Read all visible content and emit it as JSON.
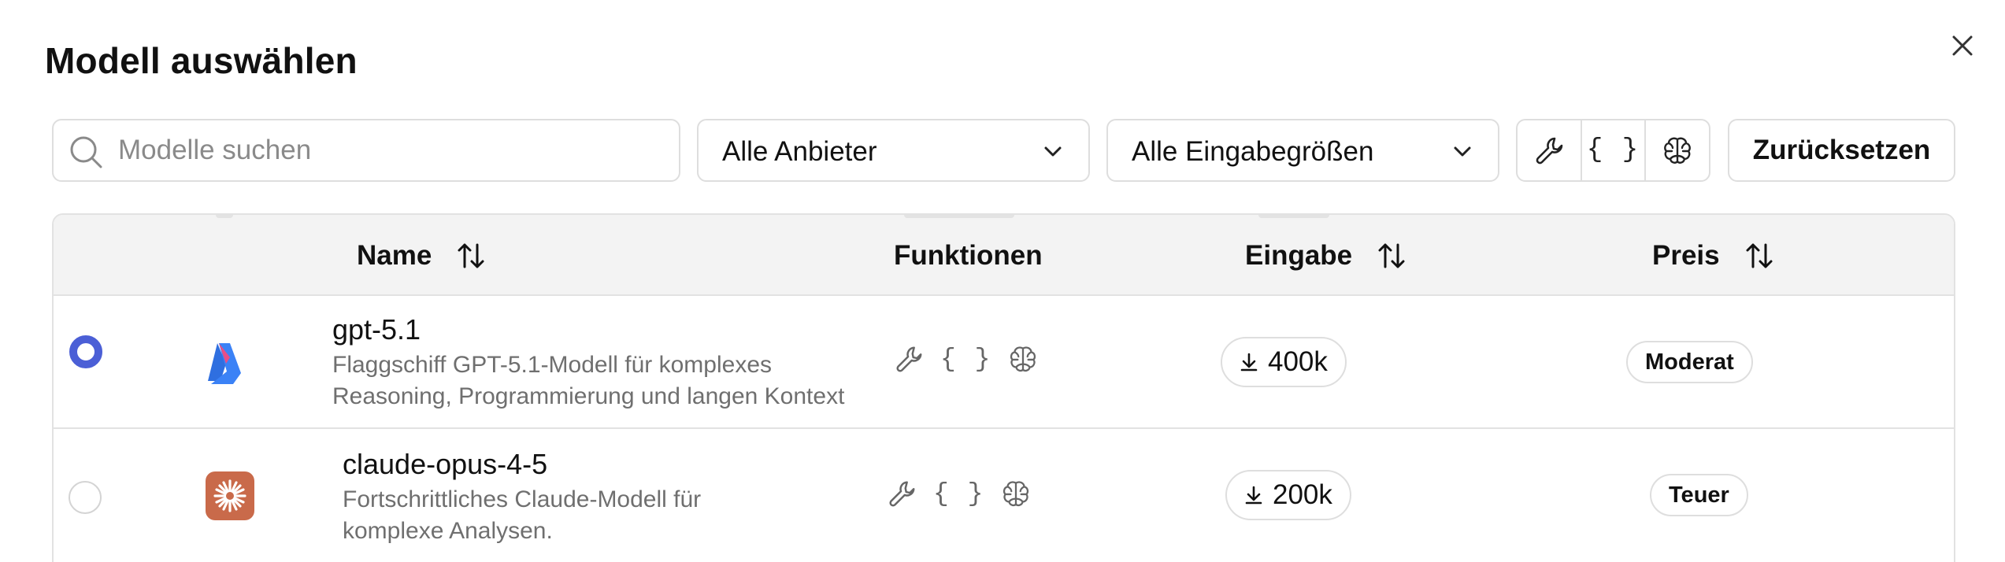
{
  "dialog": {
    "title": "Modell auswählen",
    "close_icon": "close-icon"
  },
  "toolbar": {
    "search": {
      "placeholder": "Modelle suchen",
      "value": "",
      "icon": "search-icon"
    },
    "provider_filter": {
      "value": "Alle Anbieter",
      "icon": "chevron-down-icon"
    },
    "input_size_filter": {
      "value": "Alle Eingabegrößen",
      "icon": "chevron-down-icon"
    },
    "feature_toggles": [
      {
        "name": "tools",
        "icon": "wrench-icon"
      },
      {
        "name": "structured-output",
        "icon": "braces-icon",
        "glyph": "{ }"
      },
      {
        "name": "reasoning",
        "icon": "brain-icon"
      }
    ],
    "reset_label": "Zurücksetzen"
  },
  "table": {
    "columns": [
      {
        "label": "Name",
        "sortable": true
      },
      {
        "label": "Funktionen",
        "sortable": false
      },
      {
        "label": "Eingabe",
        "sortable": true
      },
      {
        "label": "Preis",
        "sortable": true
      }
    ],
    "rows": [
      {
        "selected": true,
        "logo": "azure-logo-icon",
        "name": "gpt-5.1",
        "description": "Flaggschiff GPT-5.1-Modell für komplexes Reasoning, Programmierung und langen Kontext",
        "features": [
          "wrench-icon",
          "braces-icon",
          "brain-icon"
        ],
        "braces_glyph": "{ }",
        "input": "400k",
        "price": "Moderat"
      },
      {
        "selected": false,
        "logo": "anthropic-logo-icon",
        "name": "claude-opus-4-5",
        "description": "Fortschrittliches Claude-Modell für komplexe Analysen.",
        "features": [
          "wrench-icon",
          "braces-icon",
          "brain-icon"
        ],
        "braces_glyph": "{ }",
        "input": "200k",
        "price": "Teuer"
      }
    ]
  },
  "colors": {
    "accent": "#4b5fd6",
    "anthropic_logo": "#c96a4a",
    "azure_logo": "#2f6fe0",
    "muted_text": "#6f6f6f",
    "border": "#dedede",
    "header_bg": "#f3f3f3"
  }
}
